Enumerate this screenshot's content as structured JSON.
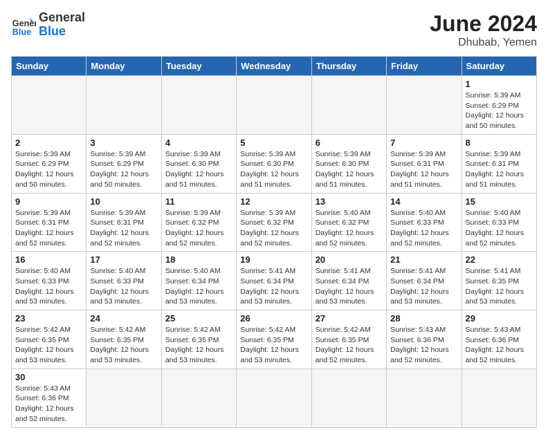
{
  "header": {
    "logo_general": "General",
    "logo_blue": "Blue",
    "month_year": "June 2024",
    "location": "Dhubab, Yemen"
  },
  "days_of_week": [
    "Sunday",
    "Monday",
    "Tuesday",
    "Wednesday",
    "Thursday",
    "Friday",
    "Saturday"
  ],
  "weeks": [
    [
      {
        "day": "",
        "info": ""
      },
      {
        "day": "",
        "info": ""
      },
      {
        "day": "",
        "info": ""
      },
      {
        "day": "",
        "info": ""
      },
      {
        "day": "",
        "info": ""
      },
      {
        "day": "",
        "info": ""
      },
      {
        "day": "1",
        "info": "Sunrise: 5:39 AM\nSunset: 6:29 PM\nDaylight: 12 hours and 50 minutes."
      }
    ],
    [
      {
        "day": "2",
        "info": "Sunrise: 5:39 AM\nSunset: 6:29 PM\nDaylight: 12 hours and 50 minutes."
      },
      {
        "day": "3",
        "info": "Sunrise: 5:39 AM\nSunset: 6:29 PM\nDaylight: 12 hours and 50 minutes."
      },
      {
        "day": "4",
        "info": "Sunrise: 5:39 AM\nSunset: 6:30 PM\nDaylight: 12 hours and 51 minutes."
      },
      {
        "day": "5",
        "info": "Sunrise: 5:39 AM\nSunset: 6:30 PM\nDaylight: 12 hours and 51 minutes."
      },
      {
        "day": "6",
        "info": "Sunrise: 5:39 AM\nSunset: 6:30 PM\nDaylight: 12 hours and 51 minutes."
      },
      {
        "day": "7",
        "info": "Sunrise: 5:39 AM\nSunset: 6:31 PM\nDaylight: 12 hours and 51 minutes."
      },
      {
        "day": "8",
        "info": "Sunrise: 5:39 AM\nSunset: 6:31 PM\nDaylight: 12 hours and 51 minutes."
      }
    ],
    [
      {
        "day": "9",
        "info": "Sunrise: 5:39 AM\nSunset: 6:31 PM\nDaylight: 12 hours and 52 minutes."
      },
      {
        "day": "10",
        "info": "Sunrise: 5:39 AM\nSunset: 6:31 PM\nDaylight: 12 hours and 52 minutes."
      },
      {
        "day": "11",
        "info": "Sunrise: 5:39 AM\nSunset: 6:32 PM\nDaylight: 12 hours and 52 minutes."
      },
      {
        "day": "12",
        "info": "Sunrise: 5:39 AM\nSunset: 6:32 PM\nDaylight: 12 hours and 52 minutes."
      },
      {
        "day": "13",
        "info": "Sunrise: 5:40 AM\nSunset: 6:32 PM\nDaylight: 12 hours and 52 minutes."
      },
      {
        "day": "14",
        "info": "Sunrise: 5:40 AM\nSunset: 6:33 PM\nDaylight: 12 hours and 52 minutes."
      },
      {
        "day": "15",
        "info": "Sunrise: 5:40 AM\nSunset: 6:33 PM\nDaylight: 12 hours and 52 minutes."
      }
    ],
    [
      {
        "day": "16",
        "info": "Sunrise: 5:40 AM\nSunset: 6:33 PM\nDaylight: 12 hours and 53 minutes."
      },
      {
        "day": "17",
        "info": "Sunrise: 5:40 AM\nSunset: 6:33 PM\nDaylight: 12 hours and 53 minutes."
      },
      {
        "day": "18",
        "info": "Sunrise: 5:40 AM\nSunset: 6:34 PM\nDaylight: 12 hours and 53 minutes."
      },
      {
        "day": "19",
        "info": "Sunrise: 5:41 AM\nSunset: 6:34 PM\nDaylight: 12 hours and 53 minutes."
      },
      {
        "day": "20",
        "info": "Sunrise: 5:41 AM\nSunset: 6:34 PM\nDaylight: 12 hours and 53 minutes."
      },
      {
        "day": "21",
        "info": "Sunrise: 5:41 AM\nSunset: 6:34 PM\nDaylight: 12 hours and 53 minutes."
      },
      {
        "day": "22",
        "info": "Sunrise: 5:41 AM\nSunset: 6:35 PM\nDaylight: 12 hours and 53 minutes."
      }
    ],
    [
      {
        "day": "23",
        "info": "Sunrise: 5:42 AM\nSunset: 6:35 PM\nDaylight: 12 hours and 53 minutes."
      },
      {
        "day": "24",
        "info": "Sunrise: 5:42 AM\nSunset: 6:35 PM\nDaylight: 12 hours and 53 minutes."
      },
      {
        "day": "25",
        "info": "Sunrise: 5:42 AM\nSunset: 6:35 PM\nDaylight: 12 hours and 53 minutes."
      },
      {
        "day": "26",
        "info": "Sunrise: 5:42 AM\nSunset: 6:35 PM\nDaylight: 12 hours and 53 minutes."
      },
      {
        "day": "27",
        "info": "Sunrise: 5:42 AM\nSunset: 6:35 PM\nDaylight: 12 hours and 52 minutes."
      },
      {
        "day": "28",
        "info": "Sunrise: 5:43 AM\nSunset: 6:36 PM\nDaylight: 12 hours and 52 minutes."
      },
      {
        "day": "29",
        "info": "Sunrise: 5:43 AM\nSunset: 6:36 PM\nDaylight: 12 hours and 52 minutes."
      }
    ],
    [
      {
        "day": "30",
        "info": "Sunrise: 5:43 AM\nSunset: 6:36 PM\nDaylight: 12 hours and 52 minutes."
      },
      {
        "day": "",
        "info": ""
      },
      {
        "day": "",
        "info": ""
      },
      {
        "day": "",
        "info": ""
      },
      {
        "day": "",
        "info": ""
      },
      {
        "day": "",
        "info": ""
      },
      {
        "day": "",
        "info": ""
      }
    ]
  ]
}
